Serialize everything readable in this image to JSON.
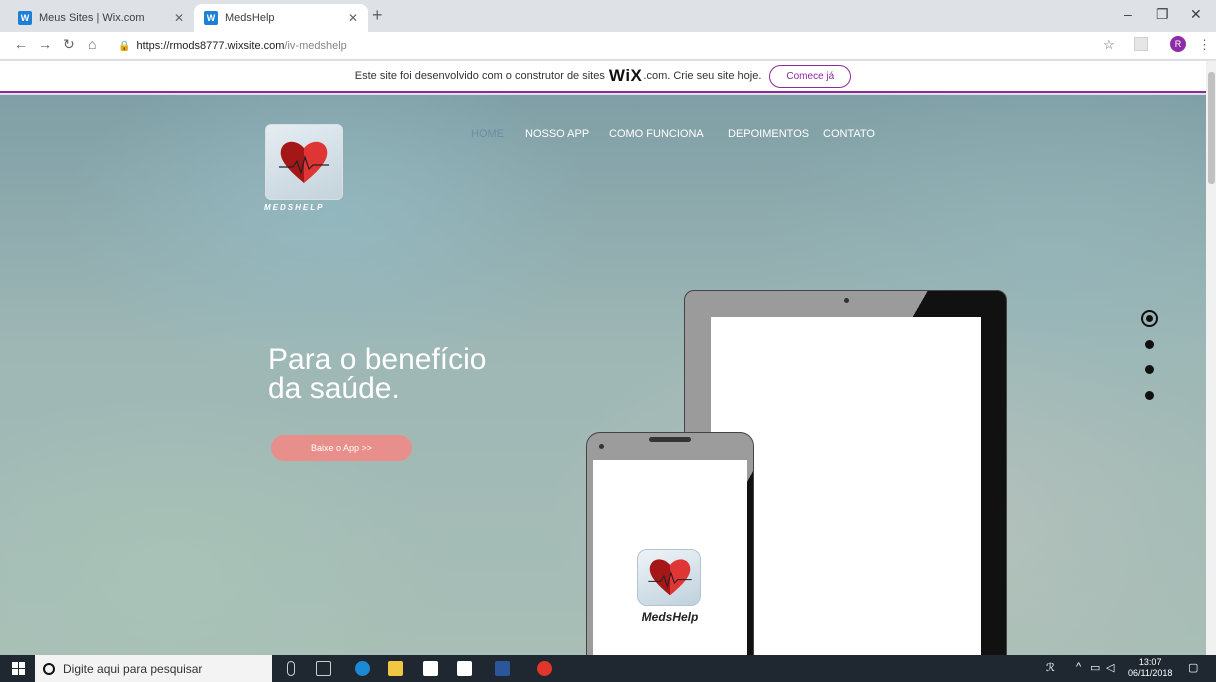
{
  "browser": {
    "tabs": [
      {
        "title": "Meus Sites | Wix.com",
        "active": false
      },
      {
        "title": "MedsHelp",
        "active": true
      }
    ],
    "url_host": "https://rmods8777.wixsite.com",
    "url_path": "/iv-medshelp",
    "profile_initial": "R"
  },
  "wix_banner": {
    "text_before": "Este site foi desenvolvido com o construtor de sites",
    "wix_logo": "WiX",
    "text_after": ".com. Crie seu site hoje.",
    "cta": "Comece já"
  },
  "site": {
    "logo_text": "MEDSHELP",
    "nav": [
      {
        "label": "HOME",
        "active": true
      },
      {
        "label": "NOSSO APP",
        "active": false
      },
      {
        "label": "COMO FUNCIONA",
        "active": false
      },
      {
        "label": "DEPOIMENTOS",
        "active": false
      },
      {
        "label": "CONTATO",
        "active": false
      }
    ],
    "headline_line1": "Para o benefício",
    "headline_line2": "da saúde.",
    "download_button": "Baixe o App >>",
    "slide_dots": 4,
    "active_slide": 1,
    "app_label": "MedsHelp",
    "colors": {
      "accent": "#8c2a9c",
      "button": "#e88f8b",
      "heart": "#d42a2a"
    }
  },
  "taskbar": {
    "search_placeholder": "Digite aqui para pesquisar",
    "time": "13:07",
    "date": "06/11/2018"
  }
}
